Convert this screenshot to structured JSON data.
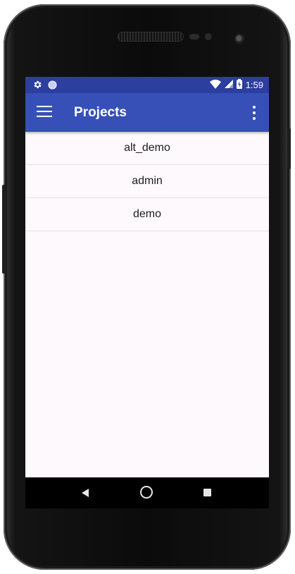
{
  "device": {
    "icons": {
      "speaker": "speaker-grille-icon",
      "camera": "front-camera-icon"
    }
  },
  "status_bar": {
    "time": "1:59",
    "icons": [
      "settings-gear-icon",
      "sync-circle-icon",
      "wifi-icon",
      "cell-signal-icon",
      "battery-charging-icon"
    ],
    "background": "#2c3e9e"
  },
  "app_bar": {
    "title": "Projects",
    "menu_icon": "hamburger-menu-icon",
    "overflow_icon": "more-vert-icon",
    "background": "#3650b8"
  },
  "projects": [
    {
      "name": "alt_demo"
    },
    {
      "name": "admin"
    },
    {
      "name": "demo"
    }
  ],
  "nav_bar": {
    "buttons": [
      "back-icon",
      "home-icon",
      "recents-icon"
    ]
  },
  "colors": {
    "screen_background": "#fdf9fc",
    "divider": "#e4e0e3",
    "text": "#1e1e1e"
  }
}
